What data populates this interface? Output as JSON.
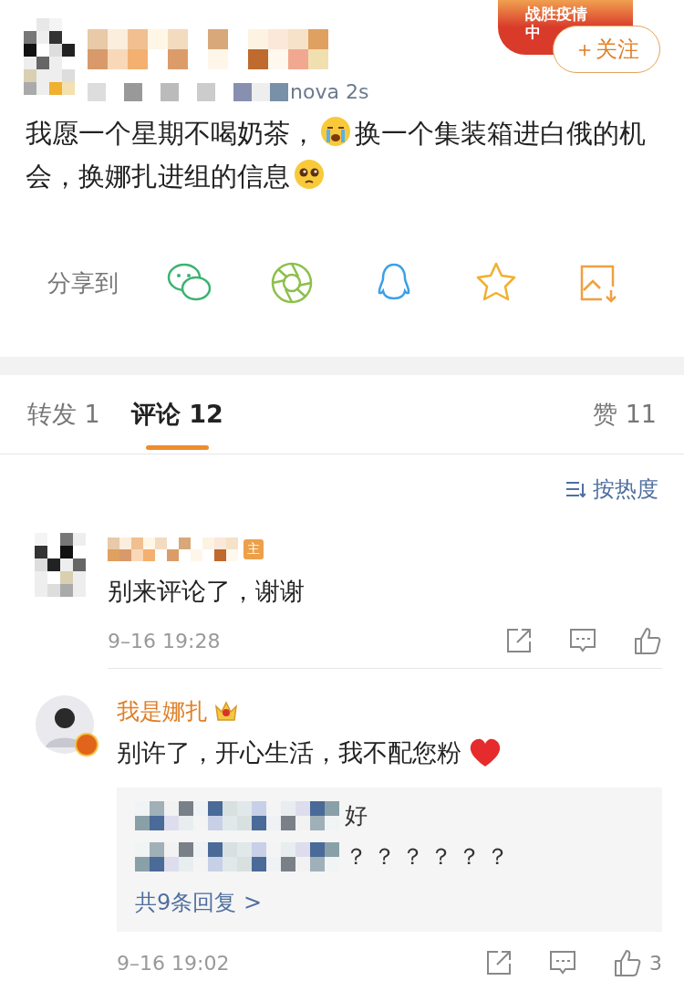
{
  "post": {
    "badge_text": [
      "战胜疫情",
      "中"
    ],
    "follow_button": "＋关注",
    "device": "nova 2s",
    "segments": [
      {
        "kind": "text",
        "text": "我愿一个星期不喝奶茶，"
      },
      {
        "kind": "crying-emoji"
      },
      {
        "kind": "text",
        "text": "换一个集装箱进白俄的机会，换娜扎进组的信息"
      },
      {
        "kind": "pleading-emoji"
      }
    ]
  },
  "share": {
    "label": "分享到"
  },
  "tabs": [
    {
      "label": "转发",
      "count": "1",
      "selected": false
    },
    {
      "label": "评论",
      "count": "12",
      "selected": true
    },
    {
      "label": "赞",
      "count": "11",
      "selected": false
    }
  ],
  "sort": {
    "label": "按热度"
  },
  "comments": [
    {
      "kind": "hidden",
      "badge": "主",
      "text": "别来评论了，谢谢",
      "time": "9–16 19:28"
    },
    {
      "kind": "verified",
      "name": "我是娜扎",
      "text": "别许了，开心生活，我不配您粉",
      "replies": [
        {
          "text": "好"
        },
        {
          "text": "？？？？？？"
        }
      ],
      "more": "共9条回复 >",
      "time": "9–16 19:02",
      "likes": "3"
    }
  ]
}
